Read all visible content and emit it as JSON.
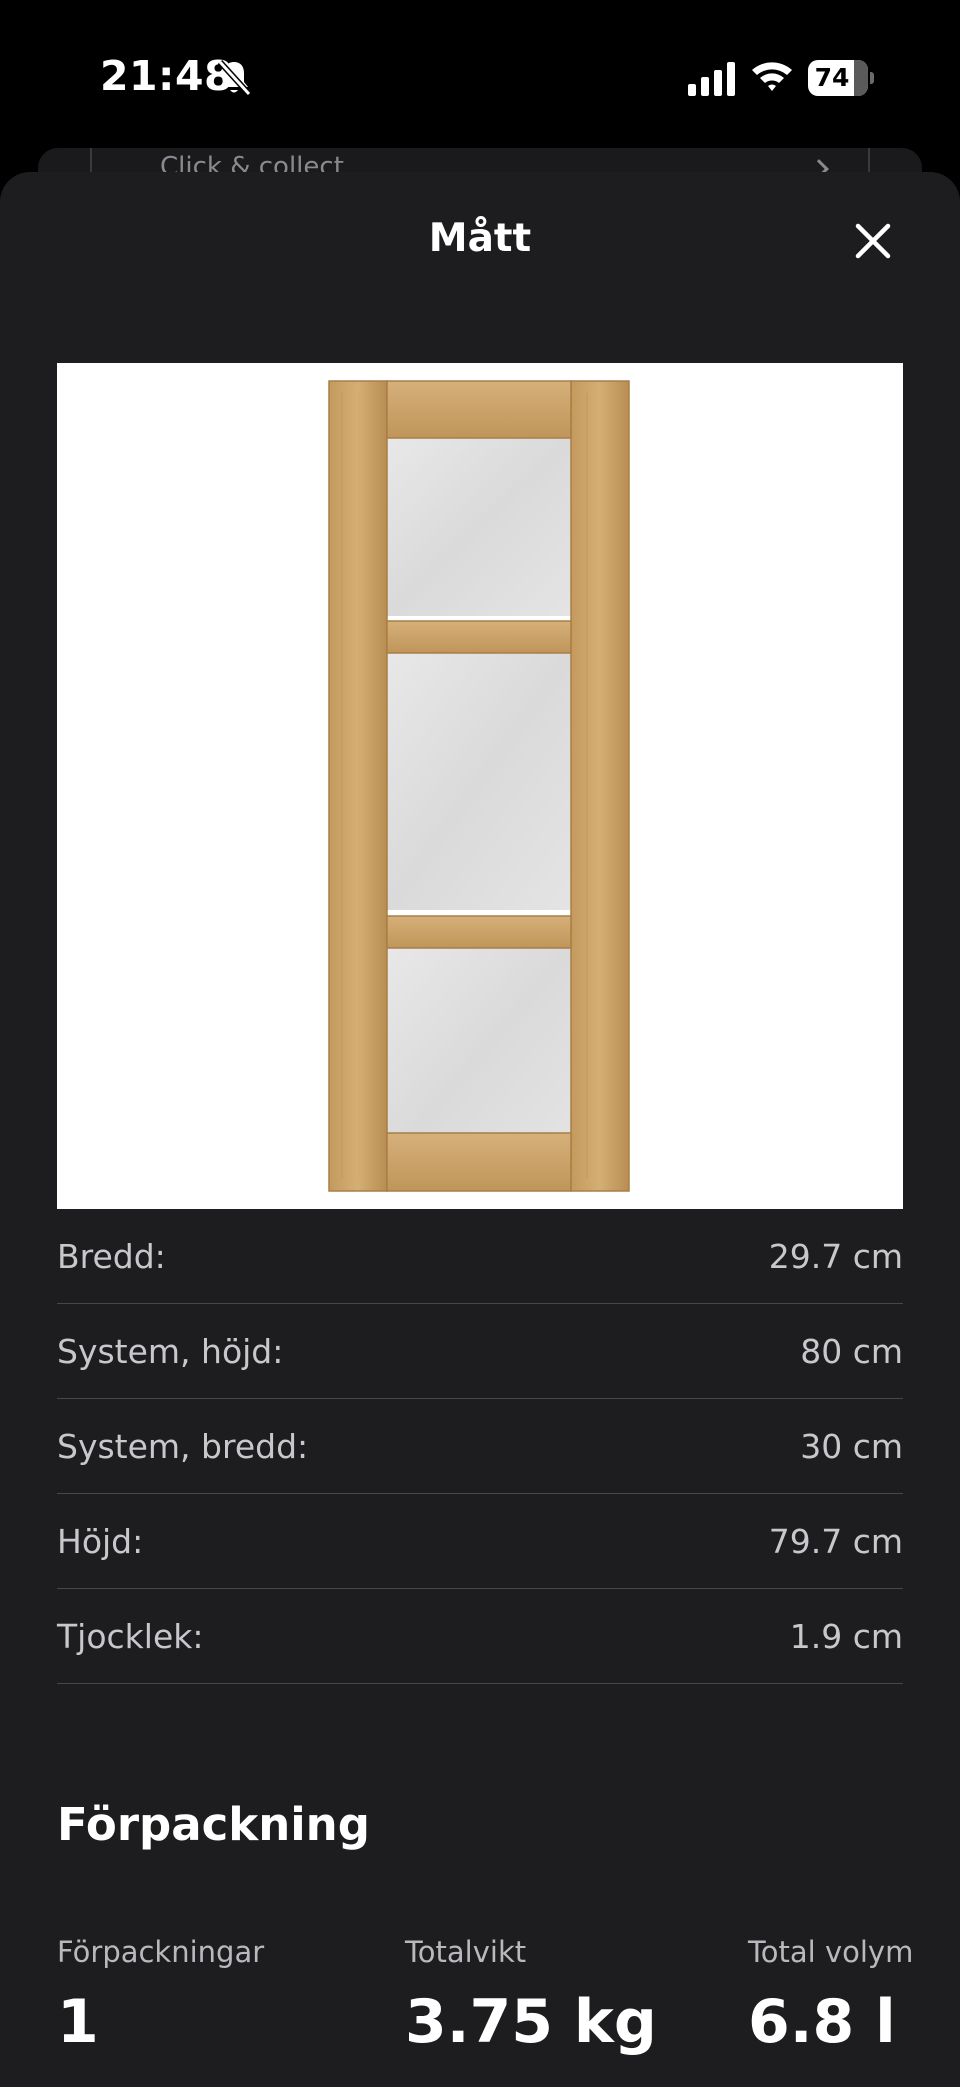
{
  "status_bar": {
    "time": "21:48",
    "battery": "74",
    "icons": [
      "bell-slash-icon",
      "cellular-signal-icon",
      "wifi-icon",
      "battery-icon"
    ]
  },
  "background_card": {
    "text": "Click & collect"
  },
  "sheet": {
    "title": "Mått",
    "close_icon": "close-icon",
    "image_alt": "Glass cabinet door with oak frame"
  },
  "dimensions": [
    {
      "label": "Bredd:",
      "value": "29.7 cm"
    },
    {
      "label": "System, höjd:",
      "value": "80 cm"
    },
    {
      "label": "System, bredd:",
      "value": "30 cm"
    },
    {
      "label": "Höjd:",
      "value": "79.7 cm"
    },
    {
      "label": "Tjocklek:",
      "value": "1.9 cm"
    }
  ],
  "packaging": {
    "title": "Förpackning",
    "items": [
      {
        "label": "Förpackningar",
        "value": "1"
      },
      {
        "label": "Totalvikt",
        "value": "3.75 kg"
      },
      {
        "label": "Total volym",
        "value": "6.8 l"
      }
    ]
  },
  "colors": {
    "sheet_background": "#1d1d1f",
    "divider": "#48484a",
    "wood": "#c9a066"
  }
}
